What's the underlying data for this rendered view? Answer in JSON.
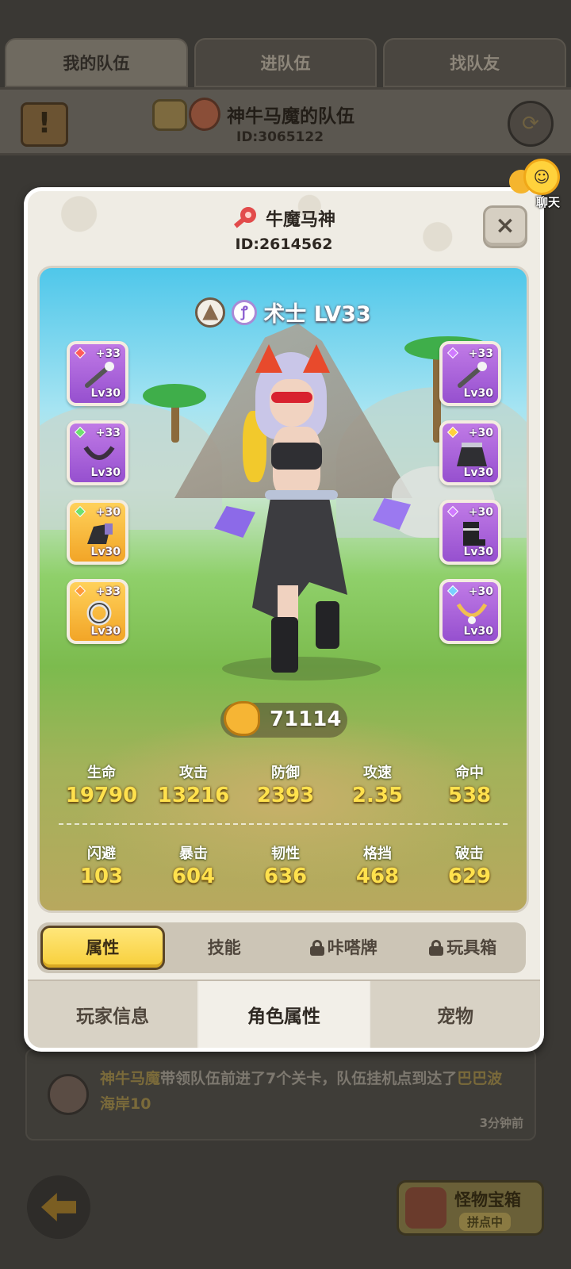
{
  "top_tabs": [
    "我的队伍",
    "进队伍",
    "找队友"
  ],
  "team": {
    "name": "神牛马魔的队伍",
    "id": "ID:3065122"
  },
  "chat": {
    "label": "聊天"
  },
  "feed": {
    "name": "神牛马魔",
    "text_mid": "带领队伍前进了7个关卡，队伍挂机点到达了",
    "place": "巴巴波海岸10",
    "time": "3分钟前"
  },
  "monster_chest": {
    "title": "怪物宝箱",
    "status": "拼点中"
  },
  "modal": {
    "player_name": "牛魔马神",
    "player_id": "ID:2614562",
    "close_label": "×",
    "class_label": "术士 LV33",
    "class_glyph": "ꝭ",
    "power": "71114",
    "left_equips": [
      {
        "plus": "+33",
        "level": "Lv30",
        "rarity": "purple",
        "gem": "#ff5a5a",
        "icon": "staff-icon"
      },
      {
        "plus": "+33",
        "level": "Lv30",
        "rarity": "purple",
        "gem": "#6ee06e",
        "icon": "necklace-icon"
      },
      {
        "plus": "+30",
        "level": "Lv30",
        "rarity": "gold",
        "gem": "#6ee06e",
        "icon": "glove-icon"
      },
      {
        "plus": "+33",
        "level": "Lv30",
        "rarity": "gold",
        "gem": "#ff9a3a",
        "icon": "ring-icon"
      }
    ],
    "right_equips": [
      {
        "plus": "+33",
        "level": "Lv30",
        "rarity": "purple",
        "gem": "#d07aff",
        "icon": "staff-icon"
      },
      {
        "plus": "+30",
        "level": "Lv30",
        "rarity": "purple",
        "gem": "#ffd23c",
        "icon": "skirt-icon"
      },
      {
        "plus": "+30",
        "level": "Lv30",
        "rarity": "purple",
        "gem": "#d07aff",
        "icon": "boots-icon"
      },
      {
        "plus": "+30",
        "level": "Lv30",
        "rarity": "purple",
        "gem": "#7ad0ff",
        "icon": "amulet-icon"
      }
    ],
    "stats_row1": [
      {
        "label": "生命",
        "value": "19790"
      },
      {
        "label": "攻击",
        "value": "13216"
      },
      {
        "label": "防御",
        "value": "2393"
      },
      {
        "label": "攻速",
        "value": "2.35"
      },
      {
        "label": "命中",
        "value": "538"
      }
    ],
    "stats_row2": [
      {
        "label": "闪避",
        "value": "103"
      },
      {
        "label": "暴击",
        "value": "604"
      },
      {
        "label": "韧性",
        "value": "636"
      },
      {
        "label": "格挡",
        "value": "468"
      },
      {
        "label": "破击",
        "value": "629"
      }
    ],
    "sub_tabs": [
      "属性",
      "技能",
      "咔嗒牌",
      "玩具箱"
    ],
    "bottom_tabs": [
      "玩家信息",
      "角色属性",
      "宠物"
    ]
  }
}
